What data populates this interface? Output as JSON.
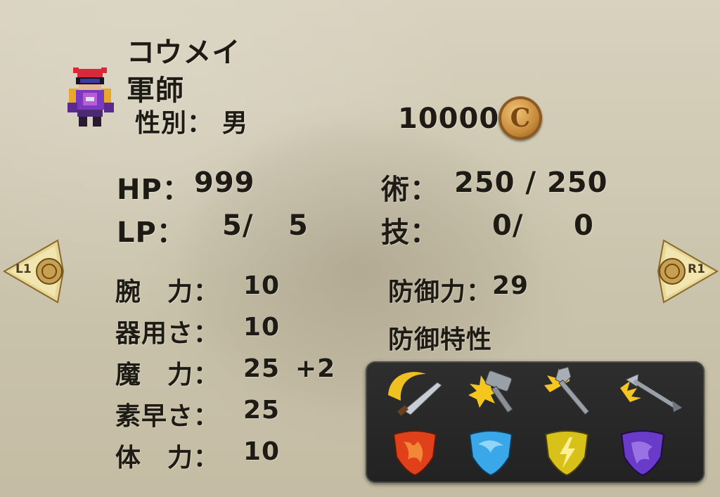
{
  "character": {
    "name": "コウメイ",
    "class": "軍師",
    "gender_label": "性別：",
    "gender": "男",
    "money": "10000",
    "coin_symbol": "C"
  },
  "stats": {
    "hp": {
      "label": "HP：",
      "value": "999"
    },
    "lp": {
      "label": "LP：",
      "current": "5/",
      "max": "5"
    },
    "jutsu": {
      "label": "術：",
      "value": "250 / 250"
    },
    "waza": {
      "label": "技：",
      "current": "0/",
      "max": "0"
    }
  },
  "attributes": [
    {
      "label": "腕　力：",
      "value": "10",
      "bonus": ""
    },
    {
      "label": "器用さ：",
      "value": "10",
      "bonus": ""
    },
    {
      "label": "魔　力：",
      "value": "25",
      "bonus": "+2"
    },
    {
      "label": "素早さ：",
      "value": "25",
      "bonus": ""
    },
    {
      "label": "体　力：",
      "value": "10",
      "bonus": ""
    }
  ],
  "defense": {
    "label": "防御力：",
    "value": "29",
    "traits_label": "防御特性",
    "physical": [
      "slash-icon",
      "blunt-icon",
      "pierce-icon",
      "projectile-icon"
    ],
    "elemental": [
      "fire-shield-icon",
      "water-shield-icon",
      "thunder-shield-icon",
      "dark-shield-icon"
    ]
  },
  "navigation": {
    "prev": "L1",
    "next": "R1"
  },
  "colors": {
    "fire": "#e0401a",
    "water": "#3aa8e8",
    "thunder": "#d8c21a",
    "dark": "#6a3ac8",
    "coin": "#c68a3a"
  }
}
